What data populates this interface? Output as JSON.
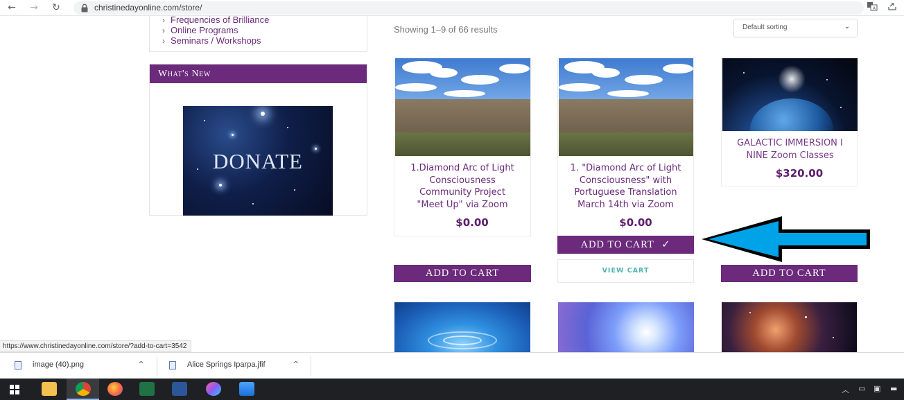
{
  "browser": {
    "url": "christinedayonline.com/store/"
  },
  "sidebar": {
    "links": [
      "Frequencies of Brilliance",
      "Online Programs",
      "Seminars / Workshops"
    ],
    "chevron": "›",
    "whats_new_title": "What's New",
    "donate_text": "DONATE"
  },
  "shop": {
    "results_text": "Showing 1–9 of 66 results",
    "sort_label": "Default sorting",
    "sort_arrow": "⌄"
  },
  "products": [
    {
      "title_lines": [
        "1.Diamond Arc of Light",
        "Consciousness",
        "Community Project",
        "\"Meet Up\" via Zoom"
      ],
      "price": "$0.00",
      "button": "ADD TO CART"
    },
    {
      "title_lines": [
        "1. \"Diamond Arc of Light",
        "Consciousness\" with",
        "Portuguese Translation",
        "March 14th via Zoom"
      ],
      "price": "$0.00",
      "button": "ADD TO CART",
      "button_check": "✓",
      "view_cart": "VIEW CART"
    },
    {
      "title_lines": [
        "GALACTIC IMMERSION I",
        "NINE Zoom Classes"
      ],
      "price": "$320.00",
      "button": "ADD TO CART"
    }
  ],
  "status_bar": {
    "url": "https://www.christinedayonline.com/store/?add-to-cart=3542"
  },
  "downloads": [
    {
      "name": "image (40).png",
      "caret": "^"
    },
    {
      "name": "Alice Springs Iparpa.jfif",
      "caret": "^"
    }
  ],
  "colors": {
    "brand_purple": "#6b2a7b",
    "arrow_blue": "#00a2e8",
    "view_cart_teal": "#4fb3b0"
  },
  "icons": {
    "back": "back-arrow-icon",
    "forward": "forward-arrow-icon",
    "reload": "reload-icon",
    "lock": "lock-icon",
    "translate": "translate-icon",
    "share": "share-icon"
  }
}
